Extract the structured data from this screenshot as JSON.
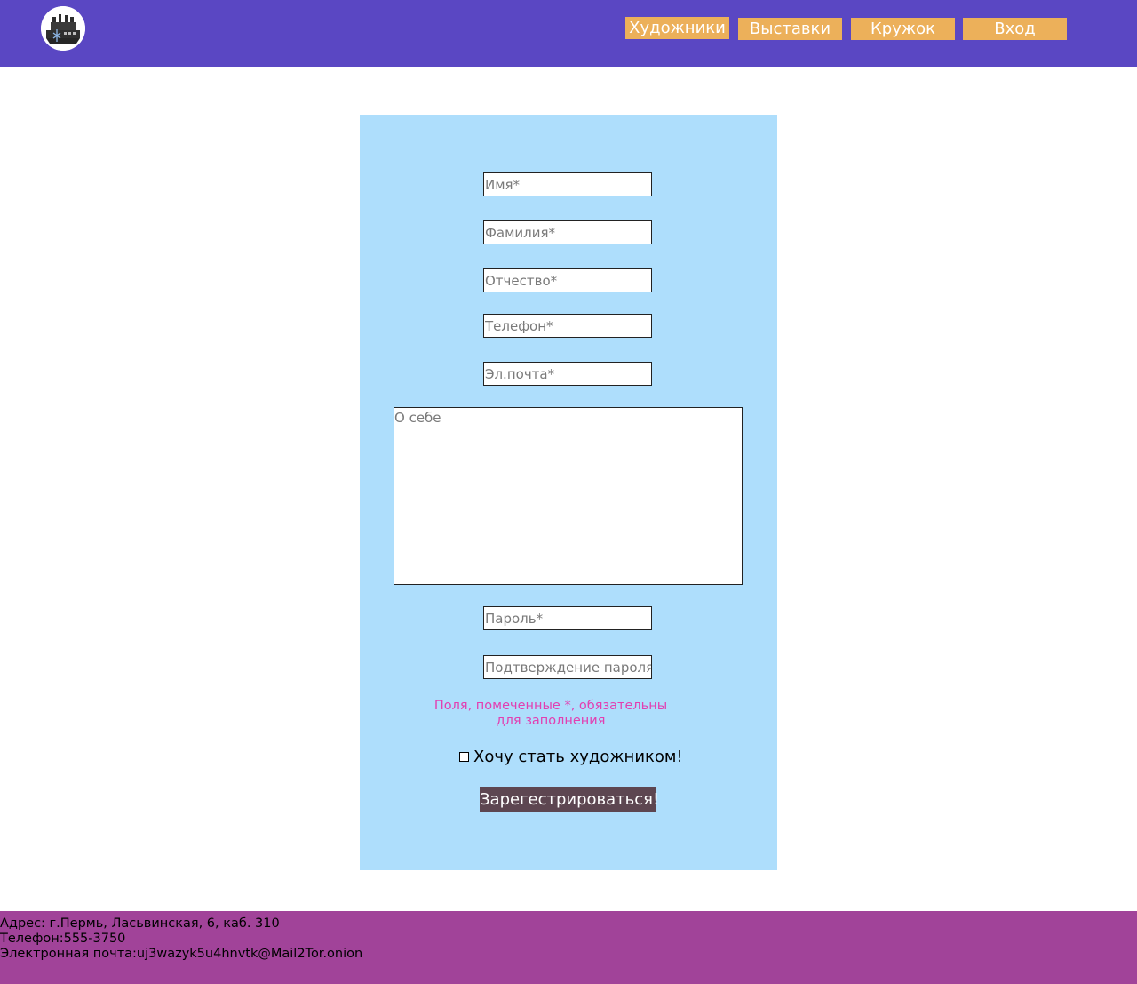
{
  "header": {
    "logo_icon": "ship-icon",
    "nav": {
      "artists": "Художники",
      "exhibitions": "Выставки",
      "circle": "Кружок",
      "login": "Вход"
    }
  },
  "form": {
    "name_placeholder": "Имя*",
    "surname_placeholder": "Фамилия*",
    "patronymic_placeholder": "Отчество*",
    "phone_placeholder": "Телефон*",
    "email_placeholder": "Эл.почта*",
    "about_placeholder": "О себе",
    "password_placeholder": "Пароль*",
    "confirm_password_placeholder": "Подтверждение пароля*",
    "required_note_line1": "Поля, помеченные *, обязательны",
    "required_note_line2": "для заполнения",
    "artist_checkbox_label": "Хочу стать художником!",
    "artist_checkbox_checked": false,
    "submit_label": "Зарегестрироваться!"
  },
  "footer": {
    "address": "Адрес: г.Пермь, Ласьвинская, 6, каб. 310",
    "phone": "Телефон:555-3750",
    "email": "Электронная почта:uj3wazyk5u4hnvtk@Mail2Tor.onion"
  },
  "colors": {
    "header_bg": "#5a47c3",
    "nav_button_bg": "#ecb05a",
    "panel_bg": "#aedefc",
    "note_text": "#e23fb1",
    "submit_bg": "#5d4651",
    "footer_bg": "#a14399"
  }
}
